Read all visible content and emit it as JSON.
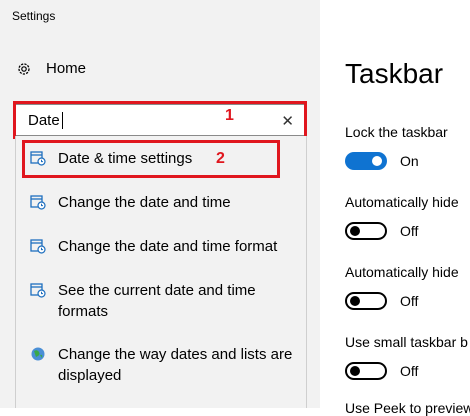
{
  "window": {
    "title": "Settings"
  },
  "nav": {
    "home_label": "Home"
  },
  "search": {
    "value": "Date",
    "clear_icon": "close-icon"
  },
  "annotations": {
    "box1": "1",
    "box2": "2",
    "color": "#e0161e"
  },
  "results": [
    {
      "label": "Date & time settings",
      "icon": "calendar-clock-icon"
    },
    {
      "label": "Change the date and time",
      "icon": "calendar-clock-icon"
    },
    {
      "label": "Change the date and time format",
      "icon": "calendar-clock-icon"
    },
    {
      "label": "See the current date and time formats",
      "icon": "calendar-clock-icon"
    },
    {
      "label": "Change the way dates and lists are displayed",
      "icon": "globe-icon"
    }
  ],
  "page": {
    "title": "Taskbar",
    "settings": [
      {
        "label": "Lock the taskbar",
        "state": "On"
      },
      {
        "label": "Automatically hide",
        "state": "Off"
      },
      {
        "label": "Automatically hide",
        "state": "Off"
      },
      {
        "label": "Use small taskbar b",
        "state": "Off"
      },
      {
        "label": "Use Peek to preview",
        "state": ""
      }
    ]
  },
  "colors": {
    "accent": "#0f73d1",
    "sidebar_bg": "#f2f2f2"
  }
}
